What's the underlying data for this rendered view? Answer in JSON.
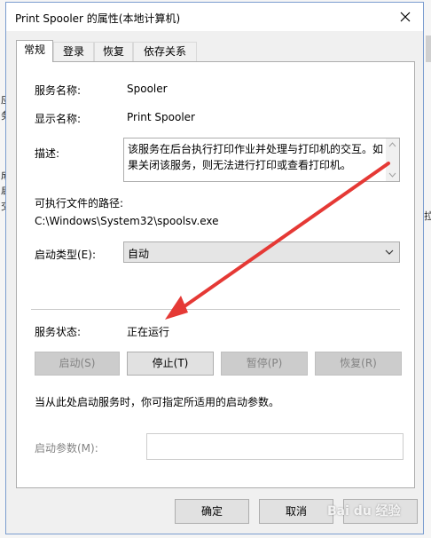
{
  "background": {
    "left_fragments": [
      "应",
      "务",
      "成",
      "启",
      "交",
      "拉"
    ]
  },
  "dialog": {
    "title": "Print Spooler 的属性(本地计算机)",
    "close_icon": "close-icon"
  },
  "tabs": [
    {
      "label": "常规",
      "active": true
    },
    {
      "label": "登录",
      "active": false
    },
    {
      "label": "恢复",
      "active": false
    },
    {
      "label": "依存关系",
      "active": false
    }
  ],
  "service": {
    "name_label": "服务名称:",
    "name_value": "Spooler",
    "display_label": "显示名称:",
    "display_value": "Print Spooler",
    "desc_label": "描述:",
    "desc_value": "该服务在后台执行打印作业并处理与打印机的交互。如果关闭该服务，则无法进行打印或查看打印机。",
    "path_label": "可执行文件的路径:",
    "path_value": "C:\\Windows\\System32\\spoolsv.exe",
    "startup_label": "启动类型(E):",
    "startup_value": "自动",
    "status_label": "服务状态:",
    "status_value": "正在运行"
  },
  "control_buttons": {
    "start": "启动(S)",
    "stop": "停止(T)",
    "pause": "暂停(P)",
    "resume": "恢复(R)"
  },
  "note": "当从此处启动服务时，你可指定所适用的启动参数。",
  "params": {
    "label": "启动参数(M):",
    "value": ""
  },
  "footer": {
    "ok": "确定",
    "cancel": "取消",
    "watermark": "Bai du 经验"
  },
  "colors": {
    "annotation_arrow": "#e53935",
    "dialog_border": "#7a9ccf"
  }
}
